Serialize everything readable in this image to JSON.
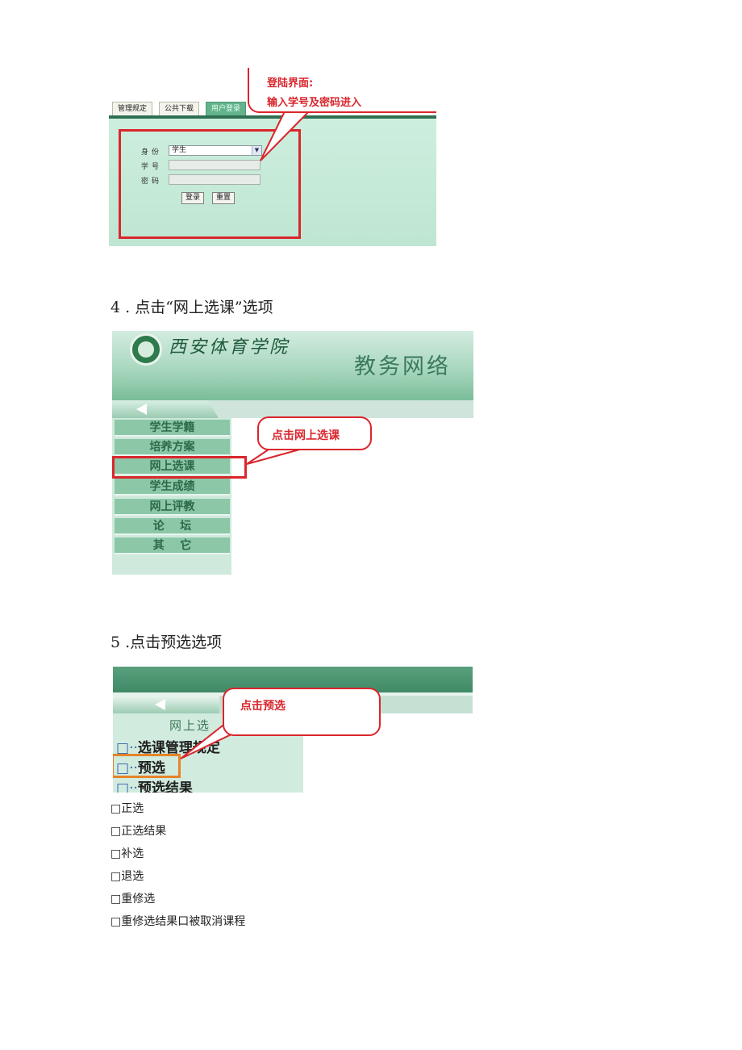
{
  "shot1": {
    "tabs": [
      "管理规定",
      "公共下载",
      "用户登录"
    ],
    "form": {
      "identity_label": "身份",
      "identity_value": "学生",
      "student_id_label": "学号",
      "password_label": "密码",
      "login_button": "登录",
      "reset_button": "重置"
    },
    "callout_line1": "登陆界面:",
    "callout_line2": "输入学号及密码进入",
    "colors": {
      "annotation": "#d9262c",
      "panel": "#c9ecda",
      "tab_active": "#63b38c"
    }
  },
  "step4": "4  . 点击“网上选课”选项",
  "shot2": {
    "school_name": "西安体育学院",
    "system_name": "教务网络",
    "menu": [
      "学生学籍",
      "培养方案",
      "网上选课",
      "学生成绩",
      "网上评教",
      "论    坛",
      "其    它"
    ],
    "callout": "点击网上选课"
  },
  "step5": "5  .点击预选选项",
  "shot3": {
    "section_title": "网上选",
    "tree": [
      {
        "icon": "□",
        "label": "选课管理规定"
      },
      {
        "icon": "□",
        "label": "预选"
      },
      {
        "icon": "□",
        "label": "预选结果"
      }
    ],
    "callout": "点击预选",
    "colors": {
      "highlight": "#e6842a"
    }
  },
  "list": [
    "□正选",
    "□正选结果",
    "□补选",
    "□退选",
    "□重修选",
    "□重修选结果口被取消课程"
  ]
}
